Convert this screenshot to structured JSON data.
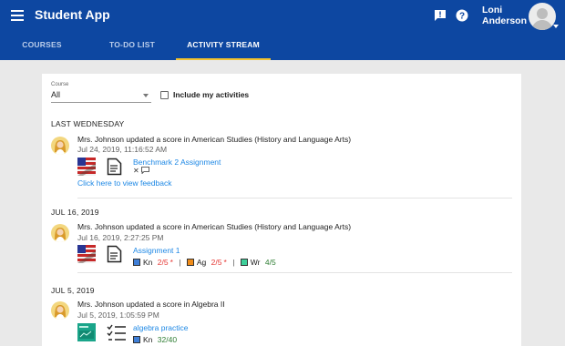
{
  "app": {
    "title": "Student App",
    "user_name": "Loni Anderson"
  },
  "tabs": [
    {
      "label": "COURSES",
      "active": false
    },
    {
      "label": "TO-DO LIST",
      "active": false
    },
    {
      "label": "ACTIVITY STREAM",
      "active": true
    }
  ],
  "filters": {
    "course_label": "Course",
    "course_value": "All",
    "include_label": "Include my activities",
    "include_checked": false
  },
  "groups": [
    {
      "heading": "LAST WEDNESDAY",
      "activities": [
        {
          "message": "Mrs. Johnson updated a score in American Studies (History and Language Arts)",
          "timestamp": "Jul 24, 2019, 11:16:52 AM",
          "assignment": "Benchmark 2 Assignment",
          "feedback_link": "Click here to view feedback"
        }
      ]
    },
    {
      "heading": "JUL 16, 2019",
      "activities": [
        {
          "message": "Mrs. Johnson updated a score in American Studies (History and Language Arts)",
          "timestamp": "Jul 16, 2019, 2:27:25 PM",
          "assignment": "Assignment 1",
          "scores": [
            {
              "code": "Kn",
              "value": "2/5",
              "flag": "*",
              "color": "#3f7fd8",
              "status": "red"
            },
            {
              "code": "Ag",
              "value": "2/5",
              "flag": "*",
              "color": "#f08c1a",
              "status": "red"
            },
            {
              "code": "Wr",
              "value": "4/5",
              "flag": "",
              "color": "#3ecf9a",
              "status": "green"
            }
          ]
        }
      ]
    },
    {
      "heading": "JUL 5, 2019",
      "activities": [
        {
          "message": "Mrs. Johnson updated a score in Algebra II",
          "timestamp": "Jul 5, 2019, 1:05:59 PM",
          "assignment": "algebra practice",
          "scores": [
            {
              "code": "Kn",
              "value": "32/40",
              "flag": "",
              "color": "#3f7fd8",
              "status": "green"
            }
          ]
        }
      ]
    }
  ]
}
